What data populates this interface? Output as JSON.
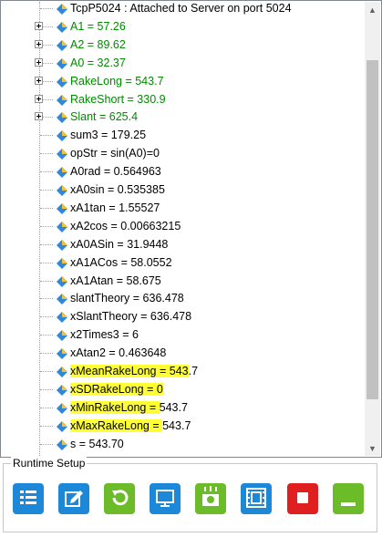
{
  "tree": {
    "items": [
      {
        "label": "TcpP5024 : Attached to Server on port 5024",
        "expandable": false,
        "green": false
      },
      {
        "label": "A1 = 57.26",
        "expandable": true,
        "green": true
      },
      {
        "label": "A2 = 89.62",
        "expandable": true,
        "green": true
      },
      {
        "label": "A0 = 32.37",
        "expandable": true,
        "green": true
      },
      {
        "label": "RakeLong = 543.7",
        "expandable": true,
        "green": true
      },
      {
        "label": "RakeShort = 330.9",
        "expandable": true,
        "green": true
      },
      {
        "label": "Slant = 625.4",
        "expandable": true,
        "green": true
      },
      {
        "label": "sum3 = 179.25",
        "expandable": false,
        "green": false
      },
      {
        "label": "opStr = sin(A0)=0",
        "expandable": false,
        "green": false
      },
      {
        "label": "A0rad = 0.564963",
        "expandable": false,
        "green": false
      },
      {
        "label": "xA0sin = 0.535385",
        "expandable": false,
        "green": false
      },
      {
        "label": "xA1tan = 1.55527",
        "expandable": false,
        "green": false
      },
      {
        "label": "xA2cos = 0.00663215",
        "expandable": false,
        "green": false
      },
      {
        "label": "xA0ASin = 31.9448",
        "expandable": false,
        "green": false
      },
      {
        "label": "xA1ACos = 58.0552",
        "expandable": false,
        "green": false
      },
      {
        "label": "xA1Atan = 58.675",
        "expandable": false,
        "green": false
      },
      {
        "label": "slantTheory = 636.478",
        "expandable": false,
        "green": false
      },
      {
        "label": "xSlantTheory = 636.478",
        "expandable": false,
        "green": false
      },
      {
        "label": "x2Times3 = 6",
        "expandable": false,
        "green": false
      },
      {
        "label": "xAtan2 = 0.463648",
        "expandable": false,
        "green": false
      },
      {
        "label": "xMeanRakeLong = 543.7",
        "highlight": "xMeanRakeLong = 543",
        "rest": ".7",
        "expandable": false,
        "green": false
      },
      {
        "label": "xSDRakeLong = 0",
        "highlight": "xSDRakeLong = 0",
        "rest": "",
        "expandable": false,
        "green": false
      },
      {
        "label": "xMinRakeLong = 543.7",
        "highlight": "xMinRakeLong = ",
        "rest": "543.7",
        "expandable": false,
        "green": false
      },
      {
        "label": "xMaxRakeLong = 543.7",
        "highlight": "xMaxRakeLong = ",
        "rest": "543.7",
        "expandable": false,
        "green": false
      },
      {
        "label": "s = 543.70",
        "expandable": false,
        "green": false
      }
    ]
  },
  "runtime_setup": {
    "title": "Runtime Setup",
    "buttons": [
      {
        "name": "list-button",
        "icon": "list-icon",
        "color": "#1e88d8"
      },
      {
        "name": "edit-button",
        "icon": "edit-icon",
        "color": "#1e88d8"
      },
      {
        "name": "reset-button",
        "icon": "refresh-icon",
        "color": "#6cbb28"
      },
      {
        "name": "display-button",
        "icon": "monitor-icon",
        "color": "#1e88d8"
      },
      {
        "name": "snapshot-button",
        "icon": "camera-icon",
        "color": "#6cbb28"
      },
      {
        "name": "film-button",
        "icon": "film-icon",
        "color": "#1e88d8"
      },
      {
        "name": "stop-button",
        "icon": "stop-icon",
        "color": "#e02020"
      },
      {
        "name": "minimize-button",
        "icon": "minimize-icon",
        "color": "#6cbb28"
      }
    ]
  },
  "colors": {
    "green_text": "#008a00",
    "highlight": "#ffff33",
    "accent_blue": "#1e88d8",
    "accent_green": "#6cbb28",
    "accent_red": "#e02020"
  }
}
